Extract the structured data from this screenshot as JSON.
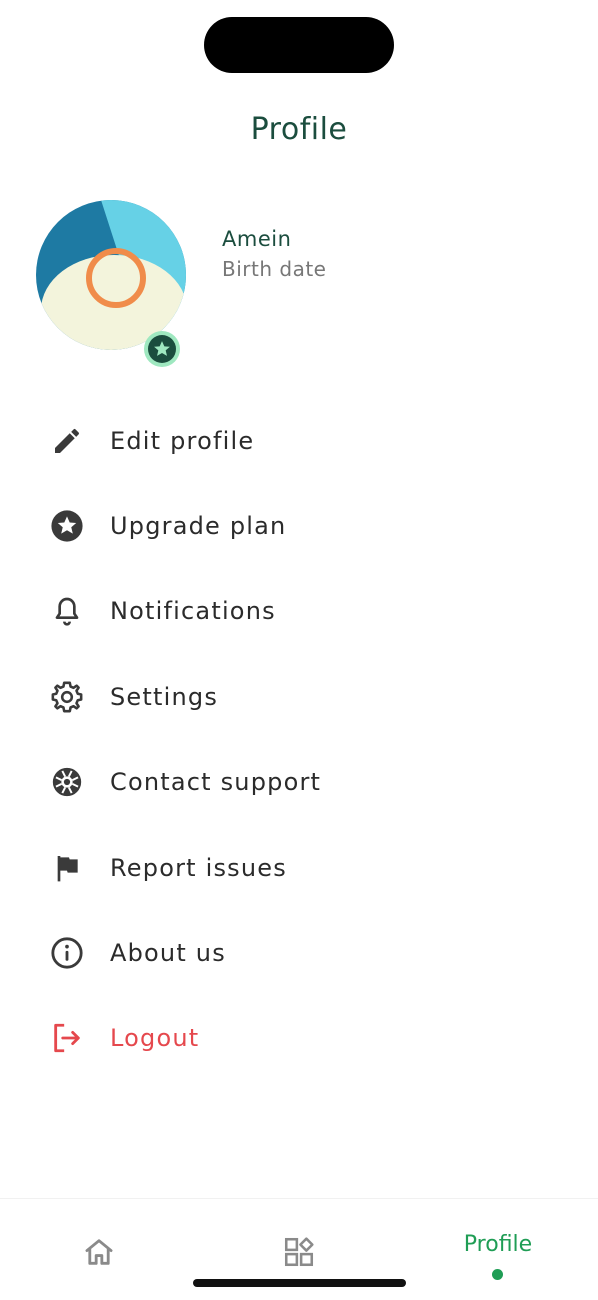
{
  "header": {
    "title": "Profile"
  },
  "user": {
    "name": "Amein",
    "subtitle": "Birth date"
  },
  "menu": [
    {
      "label": "Edit profile",
      "icon": "pencil-icon"
    },
    {
      "label": "Upgrade plan",
      "icon": "star-circle-icon"
    },
    {
      "label": "Notifications",
      "icon": "bell-icon"
    },
    {
      "label": "Settings",
      "icon": "gear-icon"
    },
    {
      "label": "Contact support",
      "icon": "lifebuoy-icon"
    },
    {
      "label": "Report issues",
      "icon": "flag-icon"
    },
    {
      "label": "About us",
      "icon": "info-icon"
    },
    {
      "label": "Logout",
      "icon": "logout-icon"
    }
  ],
  "nav": {
    "home_icon": "home-icon",
    "explore_icon": "shapes-icon",
    "profile_label": "Profile"
  },
  "colors": {
    "brand": "#1b4d3e",
    "accent": "#1f9d55",
    "danger": "#e5484d",
    "text": "#2b2b2b",
    "muted": "#777777"
  }
}
